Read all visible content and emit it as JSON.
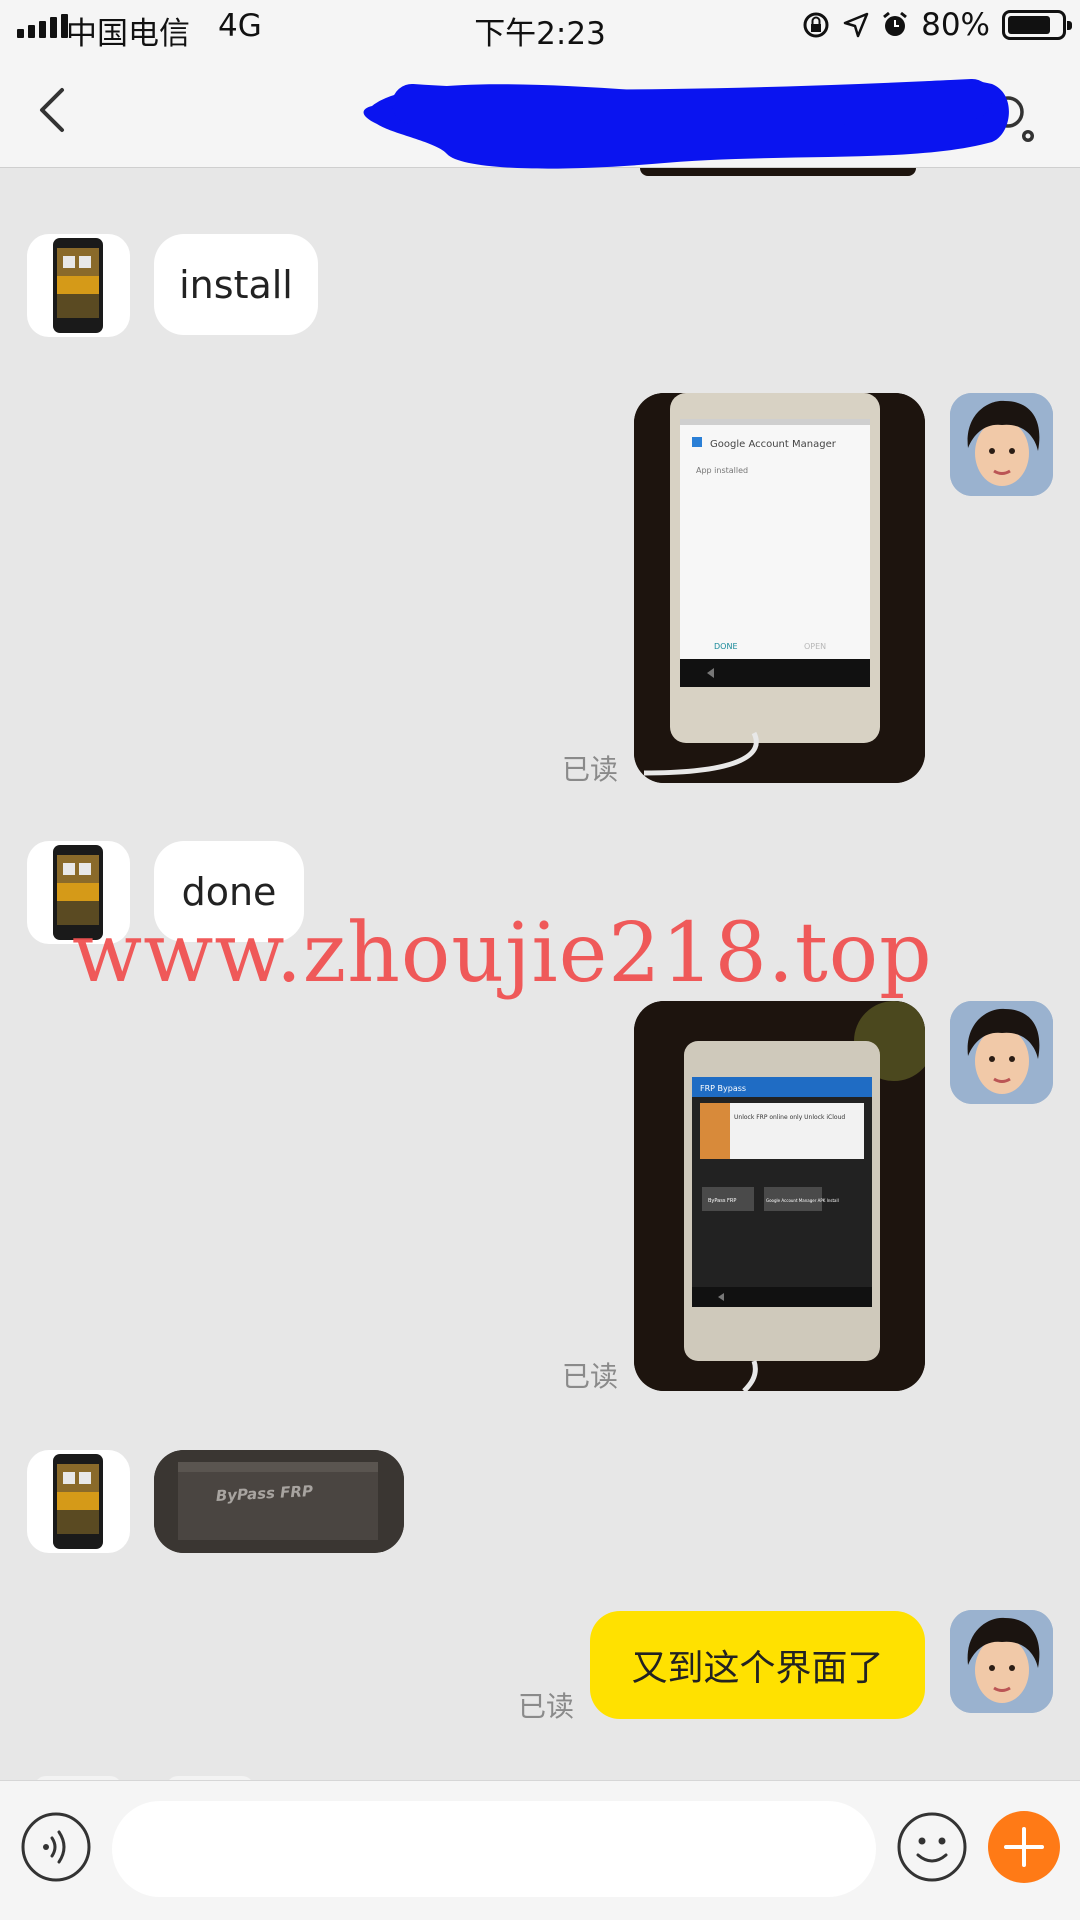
{
  "status_bar": {
    "carrier": "中国电信",
    "network": "4G",
    "time": "下午2:23",
    "battery_percent": "80%",
    "battery_level": 0.8
  },
  "nav": {
    "title": "",
    "back_icon": "chevron-left-icon",
    "settings_icon": "user-settings-icon"
  },
  "messages": [
    {
      "sender": "other",
      "type": "text",
      "text": "install"
    },
    {
      "sender": "me",
      "type": "image",
      "read": "已读",
      "image_content": {
        "dialog_title": "Google Account Manager",
        "status": "App installed",
        "buttons": [
          "DONE",
          "OPEN"
        ]
      }
    },
    {
      "sender": "other",
      "type": "text",
      "text": "done"
    },
    {
      "sender": "me",
      "type": "image",
      "read": "已读",
      "image_content": {
        "app_title": "FRP Bypass",
        "banner_text": "Unlock FRP online only Unlock iCloud",
        "buttons": [
          "ByPass FRP",
          "Google Account Manager APK Install"
        ]
      }
    },
    {
      "sender": "other",
      "type": "image",
      "image_content": {
        "text": "ByPass FRP"
      }
    },
    {
      "sender": "me",
      "type": "text",
      "text": "又到这个界面了",
      "read": "已读"
    }
  ],
  "watermark": "www.zhoujie218.top",
  "input": {
    "placeholder": "",
    "value": ""
  },
  "colors": {
    "background": "#e7e7e7",
    "my_bubble": "#ffe100",
    "other_bubble": "#ffffff",
    "accent": "#ff7a16",
    "redaction": "#0a14f0",
    "watermark": "#f05252"
  }
}
